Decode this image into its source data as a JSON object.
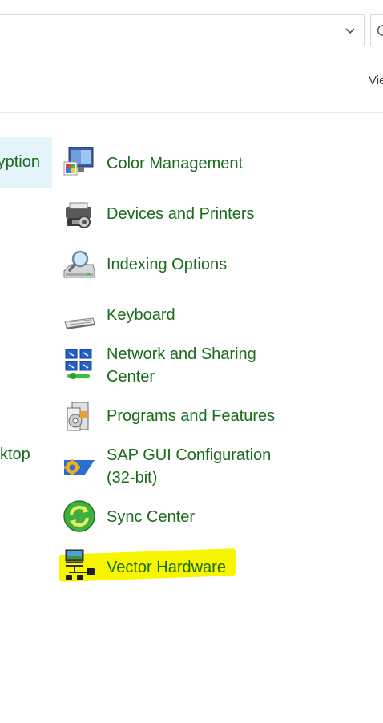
{
  "address_bar": {
    "dropdown_icon": "chevron-down-icon",
    "refresh_icon": "refresh-icon"
  },
  "header": {
    "view_by_label": "Vie"
  },
  "left_column": {
    "selected_item": "yption",
    "item2": "ktop"
  },
  "items": [
    {
      "label": "Color Management",
      "icon": "color-management-icon"
    },
    {
      "label": "Devices and Printers",
      "icon": "devices-printers-icon"
    },
    {
      "label": "Indexing Options",
      "icon": "indexing-options-icon"
    },
    {
      "label": "Keyboard",
      "icon": "keyboard-icon"
    },
    {
      "label": "Network and Sharing",
      "label2": "Center",
      "icon": "network-sharing-icon"
    },
    {
      "label": "Programs and Features",
      "icon": "programs-features-icon"
    },
    {
      "label": "SAP GUI Configuration",
      "label2": "(32-bit)",
      "icon": "sap-gui-icon"
    },
    {
      "label": "Sync Center",
      "icon": "sync-center-icon"
    },
    {
      "label": "Vector Hardware",
      "icon": "vector-hardware-icon"
    }
  ],
  "colors": {
    "link_green": "#1a6b1a",
    "selection_bg": "#e5f3fb",
    "highlight_yellow": "#f7f500"
  }
}
